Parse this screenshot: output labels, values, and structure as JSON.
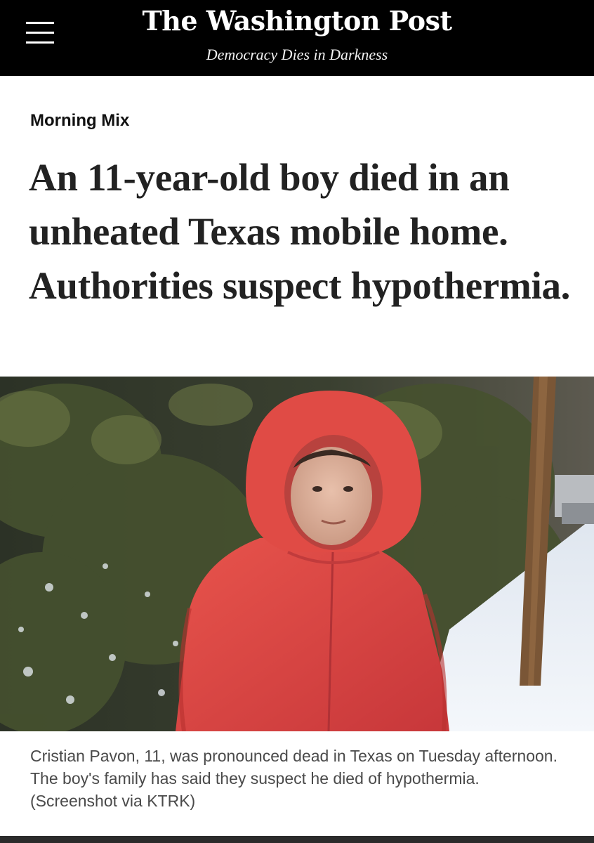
{
  "header": {
    "logo_text": "The Washington Post",
    "tagline": "Democracy Dies in Darkness",
    "menu_icon": "hamburger-menu-icon",
    "background": "#000000"
  },
  "article": {
    "section": "Morning Mix",
    "headline": "An 11-year-old boy died in an unheated Texas mobile home. Authorities suspect hypothermia.",
    "image": {
      "subject": "child in red hooded jacket standing in snow",
      "jacket_color": "#d8443e"
    },
    "caption": "Cristian Pavon, 11, was pronounced dead in Texas on Tuesday afternoon. The boy's family has said they suspect he died of hypothermia. (Screenshot via KTRK)"
  }
}
